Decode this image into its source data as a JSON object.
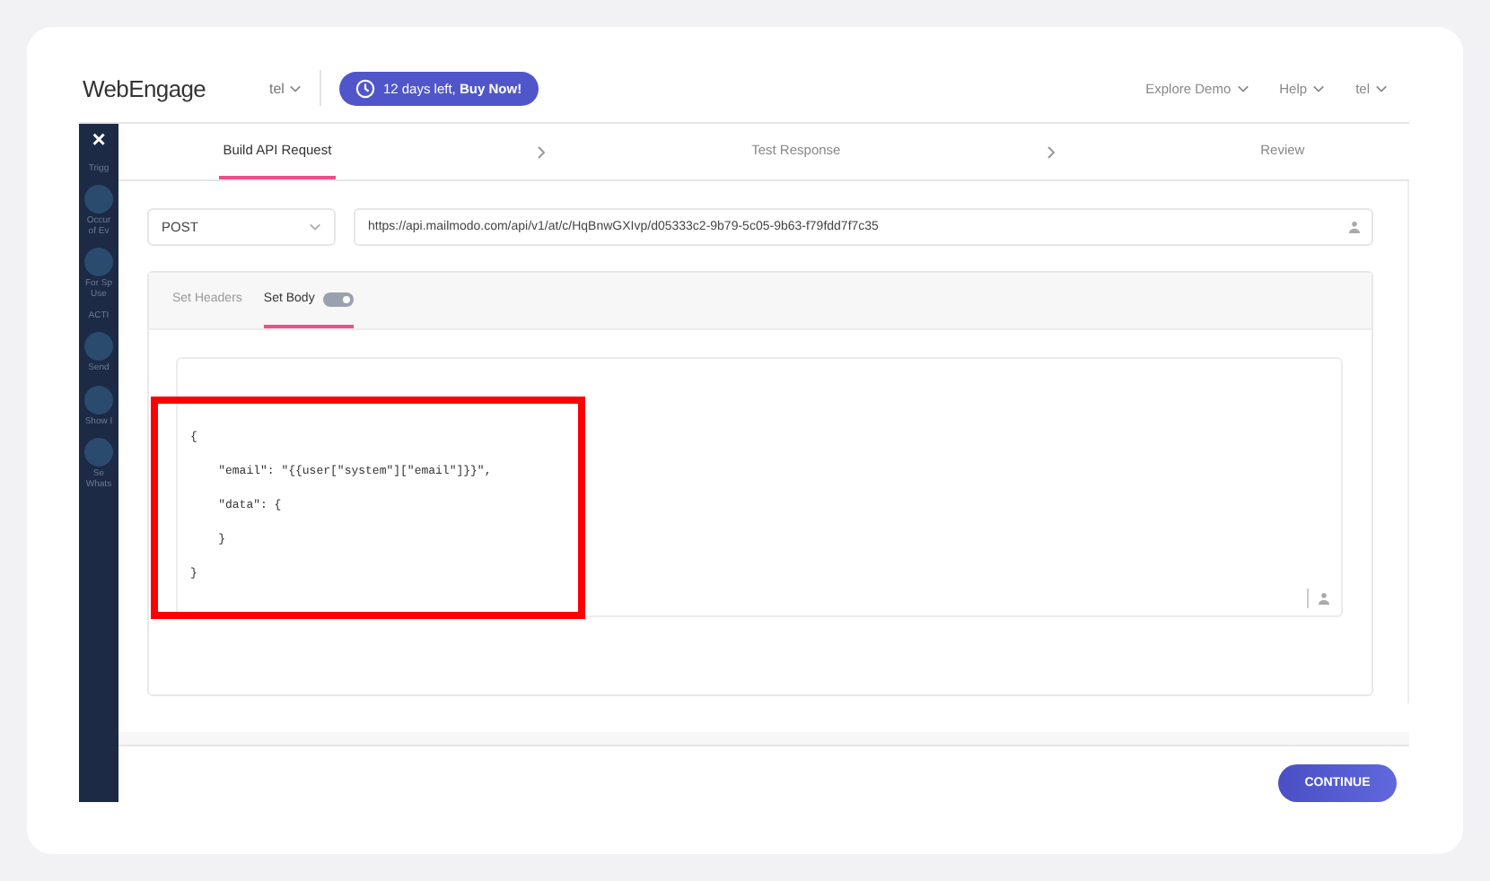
{
  "header": {
    "logo": "WebEngage",
    "account": "tel",
    "trial_button": "12 days left, **Buy Now!**",
    "nav": [
      "Explore Demo",
      "Help",
      "tel"
    ]
  },
  "sidebar": {
    "close": "×",
    "items": [
      {
        "kind": "label",
        "text": "Trigg"
      },
      {
        "kind": "icon",
        "text": "Occur\nof Ev"
      },
      {
        "kind": "icon",
        "text": "For Sp\nUse"
      },
      {
        "kind": "label",
        "text": "ACTI"
      },
      {
        "kind": "icon",
        "text": "Send"
      },
      {
        "kind": "icon",
        "text": "Show I"
      },
      {
        "kind": "icon",
        "text": "Se\nWhats"
      }
    ]
  },
  "steps": [
    {
      "label": "Build API Request",
      "selected": true
    },
    {
      "label": "Test Response",
      "selected": false
    },
    {
      "label": "Review",
      "selected": false
    }
  ],
  "request": {
    "method": "POST",
    "url": "https://api.mailmodo.com/api/v1/at/c/HqBnwGXIvp/d05333c2-9b79-5c05-9b63-f79fdd7f7c35"
  },
  "tabs": [
    {
      "label": "Set Headers",
      "selected": false
    },
    {
      "label": "Set Body",
      "selected": true,
      "toggle_on": true
    }
  ],
  "body_lines": [
    "{",
    "    \"email\": \"{{user[\"system\"][\"email\"]}}\",",
    "    \"data\": {",
    "    }",
    "}"
  ],
  "annotation": {
    "highlighted": true
  },
  "continue_button": "CONTINUE"
}
